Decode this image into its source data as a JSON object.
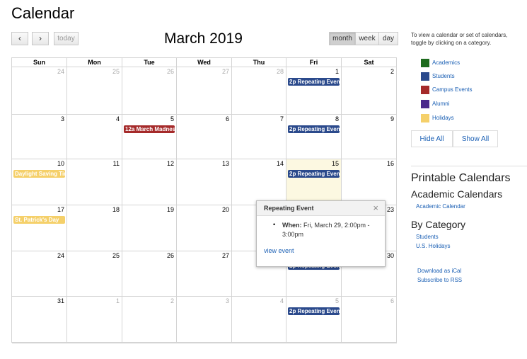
{
  "title": "Calendar",
  "toolbar": {
    "prev_icon": "‹",
    "next_icon": "›",
    "today_label": "today",
    "month_title": "March 2019",
    "views": [
      "month",
      "week",
      "day"
    ],
    "active_view": "month"
  },
  "weekdays": [
    "Sun",
    "Mon",
    "Tue",
    "Wed",
    "Thu",
    "Fri",
    "Sat"
  ],
  "weeks": [
    [
      {
        "d": "24",
        "other": true
      },
      {
        "d": "25",
        "other": true
      },
      {
        "d": "26",
        "other": true
      },
      {
        "d": "27",
        "other": true
      },
      {
        "d": "28",
        "other": true
      },
      {
        "d": "1",
        "ev": {
          "text": "2p Repeating Event",
          "color": "blue"
        }
      },
      {
        "d": "2"
      }
    ],
    [
      {
        "d": "3"
      },
      {
        "d": "4"
      },
      {
        "d": "5",
        "ev": {
          "text": "12a March Madness",
          "color": "red"
        }
      },
      {
        "d": "6"
      },
      {
        "d": "7"
      },
      {
        "d": "8",
        "ev": {
          "text": "2p Repeating Event",
          "color": "blue"
        }
      },
      {
        "d": "9"
      }
    ],
    [
      {
        "d": "10",
        "ev": {
          "text": "Daylight Saving Time",
          "color": "yellow"
        }
      },
      {
        "d": "11"
      },
      {
        "d": "12"
      },
      {
        "d": "13"
      },
      {
        "d": "14"
      },
      {
        "d": "15",
        "today": true,
        "ev": {
          "text": "2p Repeating Event",
          "color": "blue"
        }
      },
      {
        "d": "16"
      }
    ],
    [
      {
        "d": "17",
        "ev": {
          "text": "St. Patrick's Day",
          "color": "yellow"
        }
      },
      {
        "d": "18"
      },
      {
        "d": "19"
      },
      {
        "d": "20"
      },
      {
        "d": "21"
      },
      {
        "d": "22",
        "ev": {
          "text": "2p Repeating Event",
          "color": "blue"
        }
      },
      {
        "d": "23"
      }
    ],
    [
      {
        "d": "24"
      },
      {
        "d": "25"
      },
      {
        "d": "26"
      },
      {
        "d": "27"
      },
      {
        "d": "28"
      },
      {
        "d": "29",
        "ev": {
          "text": "2p Repeating Event",
          "color": "blue"
        }
      },
      {
        "d": "30"
      }
    ],
    [
      {
        "d": "31"
      },
      {
        "d": "1",
        "other": true
      },
      {
        "d": "2",
        "other": true
      },
      {
        "d": "3",
        "other": true
      },
      {
        "d": "4",
        "other": true
      },
      {
        "d": "5",
        "other": true,
        "ev": {
          "text": "2p Repeating Event",
          "color": "blue"
        }
      },
      {
        "d": "6",
        "other": true
      }
    ]
  ],
  "popup": {
    "title": "Repeating Event",
    "close_icon": "×",
    "bullet": "•",
    "when_label": "When:",
    "when_value": "Fri, March 29, 2:00pm - 3:00pm",
    "link": "view event"
  },
  "sidebar": {
    "intro": "To view a calendar or set of calendars, toggle by clicking on a category.",
    "categories": [
      {
        "label": "Academics",
        "color": "#1e6b1e"
      },
      {
        "label": "Students",
        "color": "#2b4a8c"
      },
      {
        "label": "Campus Events",
        "color": "#a52a2a"
      },
      {
        "label": "Alumni",
        "color": "#4b2a8c"
      },
      {
        "label": "Holidays",
        "color": "#f5d06a"
      }
    ],
    "hide_all": "Hide All",
    "show_all": "Show All",
    "printable_title": "Printable Calendars",
    "academic_title": "Academic Calendars",
    "academic_link": "Academic Calendar",
    "category_title": "By Category",
    "category_links": [
      "Students",
      "U.S. Holidays"
    ],
    "ical": "Download as iCal",
    "rss": "Subscribe to RSS"
  }
}
